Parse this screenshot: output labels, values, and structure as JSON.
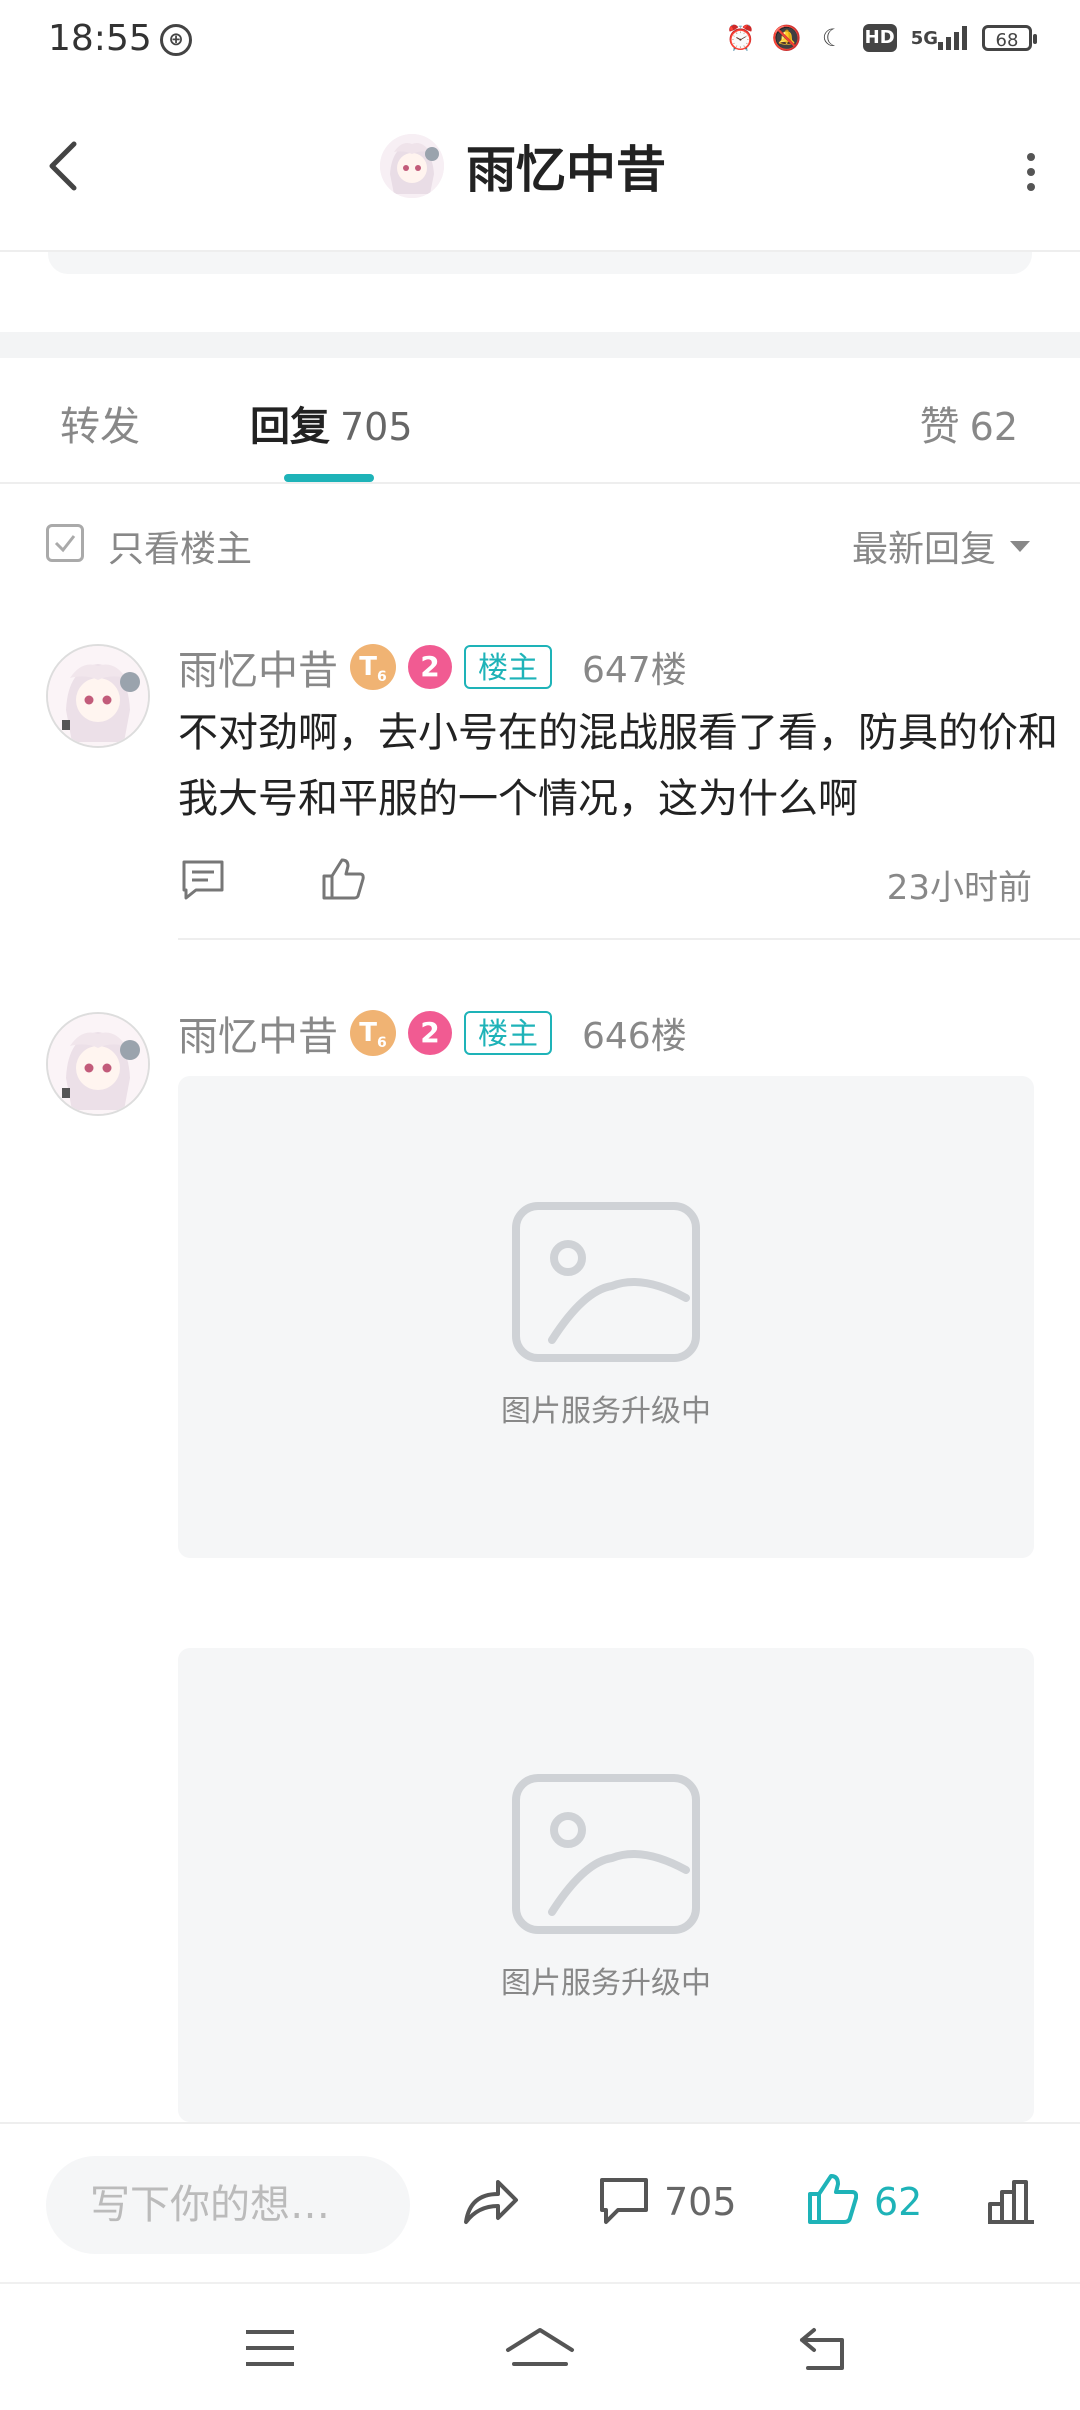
{
  "status": {
    "time": "18:55",
    "network": "5G",
    "hd": "HD",
    "battery": "68"
  },
  "header": {
    "title": "雨忆中昔"
  },
  "tabs": {
    "forward": "转发",
    "reply": "回复",
    "reply_count": "705",
    "like": "赞",
    "like_count": "62"
  },
  "filter": {
    "only_host": "只看楼主",
    "sort": "最新回复"
  },
  "posts": [
    {
      "name": "雨忆中昔",
      "level_badge": "T",
      "level_sub": "6",
      "rank": "2",
      "host_tag": "楼主",
      "floor": "647楼",
      "content": "不对劲啊，去小号在的混战服看了看，防具的价和我大号和平服的一个情况，这为什么啊",
      "time": "23小时前"
    },
    {
      "name": "雨忆中昔",
      "level_badge": "T",
      "level_sub": "6",
      "rank": "2",
      "host_tag": "楼主",
      "floor": "646楼",
      "images": [
        {
          "caption": "图片服务升级中"
        },
        {
          "caption": "图片服务升级中"
        }
      ]
    }
  ],
  "bottom": {
    "placeholder": "写下你的想…",
    "comment_count": "705",
    "like_count": "62"
  },
  "colors": {
    "accent": "#1eb3b8",
    "level_orange": "#f0b373",
    "rank_pink": "#f15b92"
  }
}
